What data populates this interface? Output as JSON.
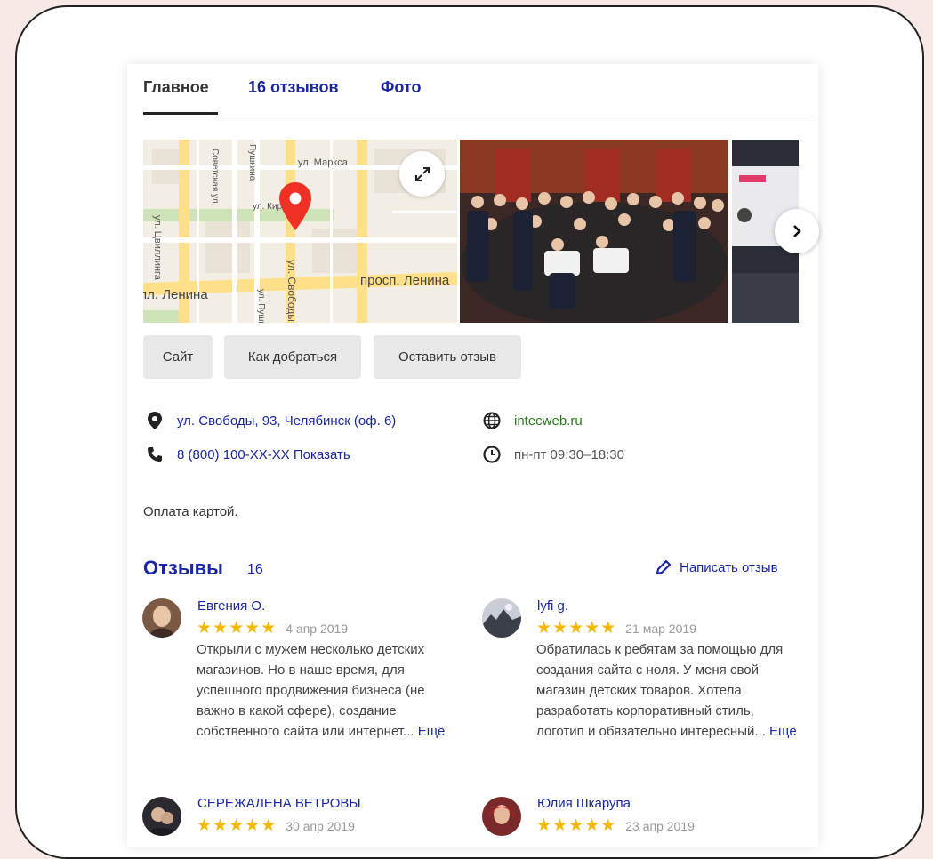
{
  "tabs": [
    {
      "label": "Главное",
      "active": true
    },
    {
      "label": "16 отзывов",
      "active": false
    },
    {
      "label": "Фото",
      "active": false
    }
  ],
  "map": {
    "streets": [
      "ул. Маркса",
      "ул. Цвиллинга",
      "Советская ул.",
      "Пушкина",
      "ул. Кирова",
      "ул. Свободы",
      "просп. Ленина",
      "пл. Ленина",
      "ул. Пушкина"
    ],
    "pin_color": "#ee3124"
  },
  "actions": {
    "site": "Сайт",
    "route": "Как добраться",
    "review": "Оставить отзыв"
  },
  "info": {
    "address": "ул. Свободы, 93, Челябинск (оф. 6)",
    "phone": "8 (800) 100-XX-XX Показать",
    "website": "intecweb.ru",
    "hours": "пн-пт 09:30–18:30"
  },
  "payment": "Оплата картой.",
  "reviews": {
    "title": "Отзывы",
    "count": "16",
    "write_label": "Написать отзыв",
    "items": [
      {
        "name": "Евгения О.",
        "stars": 5,
        "date": "4 апр 2019",
        "text": "Открыли с мужем несколько детских магазинов. Но в наше время, для успешного продвижения бизнеса (не важно в какой сфере), создание собственного сайта или интернет...",
        "more": "Ещё"
      },
      {
        "name": "lyfi g.",
        "stars": 5,
        "date": "21 мар 2019",
        "text": "Обратилась к ребятам за помощью для создания сайта с ноля. У меня свой магазин детских товаров. Хотела разработать корпоративный стиль, логотип и обязательно интересный...",
        "more": "Ещё"
      },
      {
        "name": "СЕРЕЖАЛЕНА ВЕТРОВЫ",
        "stars": 5,
        "date": "30 апр 2019"
      },
      {
        "name": "Юлия Шкарупа",
        "stars": 5,
        "date": "23 апр 2019"
      }
    ]
  },
  "colors": {
    "link": "#1a26a3",
    "star": "#f5b800",
    "website": "#2a7a1c",
    "page_bg": "#f7e9e6"
  }
}
